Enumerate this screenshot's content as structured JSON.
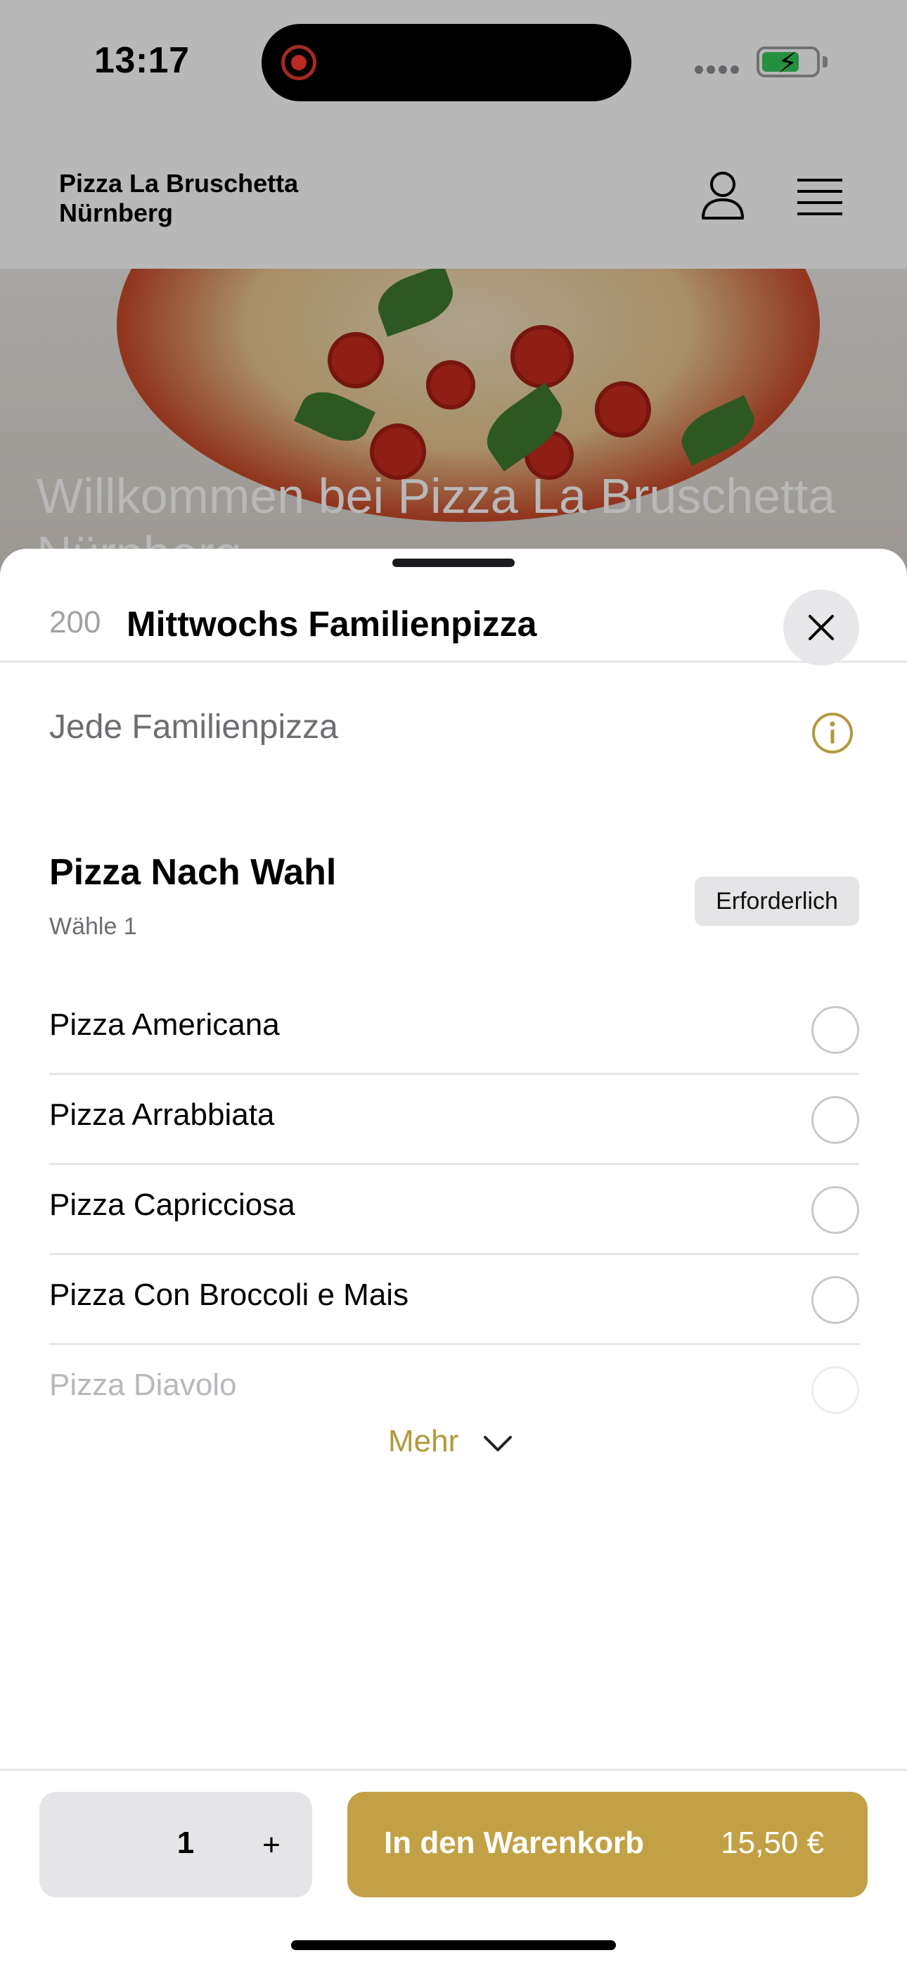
{
  "status_bar": {
    "time": "13:17"
  },
  "site": {
    "brand_line1": "Pizza La Bruschetta",
    "brand_line2": "Nürnberg",
    "hero_title": "Willkommen bei Pizza La Bruschetta Nürnberg"
  },
  "sheet": {
    "item_number": "200",
    "item_title": "Mittwochs Familienpizza",
    "description": "Jede Familienpizza",
    "group": {
      "title": "Pizza Nach Wahl",
      "subtitle": "Wähle 1",
      "badge": "Erforderlich",
      "options": [
        {
          "label": "Pizza Americana"
        },
        {
          "label": "Pizza Arrabbiata"
        },
        {
          "label": "Pizza Capricciosa"
        },
        {
          "label": "Pizza Con Broccoli e Mais"
        },
        {
          "label": "Pizza Diavolo"
        }
      ]
    },
    "more_label": "Mehr"
  },
  "footer": {
    "quantity": "1",
    "plus_label": "+",
    "cart_label": "In den Warenkorb",
    "price": "15,50 €"
  },
  "icons": {
    "user": "user-icon",
    "menu": "hamburger-menu-icon",
    "close": "close-icon",
    "info": "info-icon",
    "more": "chevron-down-icon"
  },
  "colors": {
    "accent": "#c2a146",
    "accent_text": "#b19a3d",
    "badge_bg": "#e5e5e7",
    "battery_green": "#34c759",
    "recording_red": "#ff3b30"
  }
}
